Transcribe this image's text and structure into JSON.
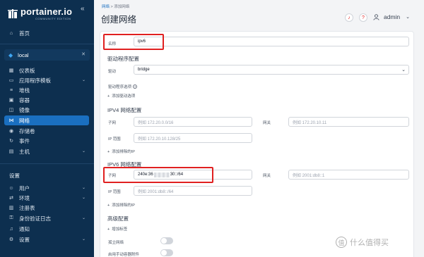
{
  "sidebar": {
    "brand": "portainer.io",
    "brand_sub": "COMMUNITY EDITION",
    "home": "首页",
    "environment": "local",
    "items": [
      {
        "label": "仪表板",
        "icon": "dashboard-icon"
      },
      {
        "label": "应用程序模板",
        "icon": "templates-icon"
      },
      {
        "label": "堆栈",
        "icon": "stacks-icon"
      },
      {
        "label": "容器",
        "icon": "containers-icon"
      },
      {
        "label": "镜像",
        "icon": "images-icon"
      },
      {
        "label": "网络",
        "icon": "network-icon"
      },
      {
        "label": "存储卷",
        "icon": "volumes-icon"
      },
      {
        "label": "事件",
        "icon": "events-icon"
      },
      {
        "label": "主机",
        "icon": "host-icon"
      }
    ],
    "settings_heading": "设置",
    "settings_items": [
      {
        "label": "用户",
        "icon": "users-icon"
      },
      {
        "label": "环境",
        "icon": "environments-icon"
      },
      {
        "label": "注册表",
        "icon": "registries-icon"
      },
      {
        "label": "身份验证日志",
        "icon": "auth-logs-icon"
      },
      {
        "label": "通知",
        "icon": "notifications-icon"
      },
      {
        "label": "设置",
        "icon": "settings-icon"
      }
    ]
  },
  "header": {
    "breadcrumb_parent": "网络",
    "breadcrumb_sep": ">",
    "breadcrumb_current": "添加网络",
    "title": "创建网络",
    "username": "admin"
  },
  "form": {
    "name_label": "名称",
    "name_value": "ipv6",
    "driver_section": "驱动程序配置",
    "driver_label": "驱动",
    "driver_value": "bridge",
    "driver_options_label": "驱动程序选项",
    "add_driver_option": "添加驱动选项",
    "ipv4_section": "IPV4 网络配置",
    "ipv4_subnet_label": "子网",
    "ipv4_subnet_placeholder": "例如 172.20.0.0/16",
    "ipv4_gateway_label": "网关",
    "ipv4_gateway_placeholder": "例如 172.20.10.11",
    "ipv4_range_label": "IP 范围",
    "ipv4_range_placeholder": "例如 172.20.10.128/25",
    "ipv4_add_excluded": "添加排除的IP",
    "ipv6_section": "IPV6 网络配置",
    "ipv6_subnet_label": "子网",
    "ipv6_subnet_prefix": "240e:36",
    "ipv6_subnet_suffix": "30::/64",
    "ipv6_gateway_label": "网关",
    "ipv6_gateway_placeholder": "例如 2001:db8::1",
    "ipv6_range_label": "IP 范围",
    "ipv6_range_placeholder": "例如 2001:db8::/64",
    "ipv6_add_excluded": "添加排除的IP",
    "advanced_section": "高级配置",
    "add_label": "增加标签",
    "isolated_label": "孤立网络",
    "manual_attach_label": "启用手动容器附件"
  },
  "watermark": {
    "icon_char": "值",
    "text": "什么值得买"
  }
}
